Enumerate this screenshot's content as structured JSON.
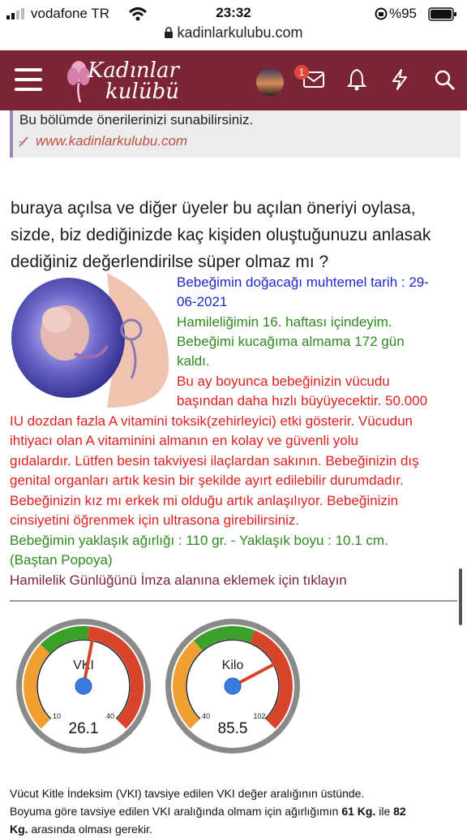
{
  "status_bar": {
    "carrier": "vodafone TR",
    "time": "23:32",
    "battery": "%95"
  },
  "browser": {
    "url": "kadinlarkulubu.com"
  },
  "header": {
    "logo_line1": "Kadınlar",
    "logo_line2": "kulübü",
    "notification_count": "1"
  },
  "quote": {
    "text": "Bu bölümde önerilerinizi sunabilirsiniz.",
    "link": "www.kadinlarkulubu.com"
  },
  "post": {
    "paragraph": "buraya açılsa ve diğer üyeler bu açılan öneriyi oylasa, sizde, biz dediğinizde kaç kişiden oluştuğunuzu anlasak dediğiniz değerlendirilse süper olmaz mı ?"
  },
  "pregnancy": {
    "due_date_line1": "Bebeğimin doğacağı muhtemel tarih : 29-",
    "due_date_line2": "06-2021",
    "week_line": "Hamileliğimin 16. haftası içindeyim.",
    "days_line1": "Bebeğimi kucağıma almama 172 gün",
    "days_line2": "kaldı.",
    "info_side_1": "Bu ay boyunca bebeğinizin vücudu",
    "info_side_2": "başından daha hızlı büyüyecektir. 50.000",
    "info_full_1": "IU dozdan fazla A vitamini toksik(zehirleyici) etki gösterir. Vücudun",
    "info_full_2": "ihtiyacı olan A vitaminini almanın en kolay ve güvenli yolu",
    "info_full_3": "gıdalardır. Lütfen besin takviyesi ilaçlardan sakının. Bebeğinizin dış",
    "info_full_4": "genital organları artık kesin bir şekilde ayırt edilebilir durumdadır.",
    "info_full_5": "Bebeğinizin kız mı erkek mi olduğu artık anlaşılıyor. Bebeğinizin",
    "info_full_6": "cinsiyetini öğrenmek için ultrasona girebilirsiniz.",
    "size_line1": "Bebeğimin yaklaşık ağırlığı : 110 gr. - Yaklaşık boyu : 10.1 cm.",
    "size_line2": "(Baştan Popoya)",
    "signature_link": "Hamilelik Günlüğünü İmza alanına eklemek için tıklayın"
  },
  "gauges": [
    {
      "label": "VKI",
      "min": "10",
      "max": "40",
      "value": "26.1",
      "fraction": 0.54
    },
    {
      "label": "Kilo",
      "min": "40",
      "max": "102",
      "value": "85.5",
      "fraction": 0.73
    }
  ],
  "footer": {
    "line1": "Vücut Kitle İndeksim (VKI) tavsiye edilen VKI değer aralığının üstünde.",
    "line2_pre": "Boyuma göre tavsiye edilen VKI aralığında olmam için ağırlığımın ",
    "line2_kg1": "61 Kg.",
    "line2_mid": " ile ",
    "line2_kg2": "82",
    "line3_kg": "Kg.",
    "line3_post": " arasında olması gerekir."
  },
  "colors": {
    "brand": "#7a2436",
    "blue_text": "#1e28c8",
    "green_text": "#2e8a1e",
    "red_text": "#e02020"
  }
}
